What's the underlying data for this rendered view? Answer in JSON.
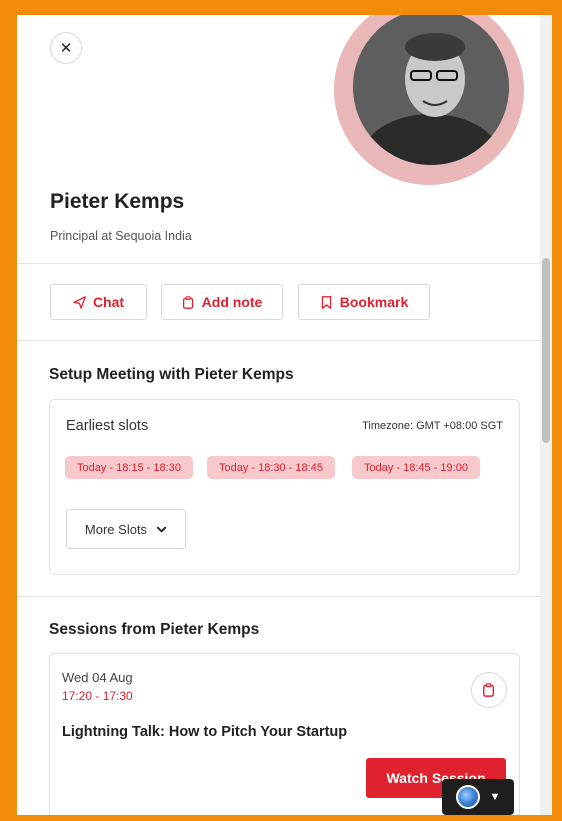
{
  "profile": {
    "name": "Pieter Kemps",
    "subtitle": "Principal at Sequoia India"
  },
  "actions": {
    "chat_label": "Chat",
    "add_note_label": "Add note",
    "bookmark_label": "Bookmark"
  },
  "meeting": {
    "title": "Setup Meeting with Pieter Kemps",
    "slots_label": "Earliest slots",
    "timezone": "Timezone: GMT +08:00 SGT",
    "slots": [
      "Today - 18:15 - 18:30",
      "Today - 18:30 - 18:45",
      "Today - 18:45 - 19:00"
    ],
    "more_slots_label": "More Slots"
  },
  "sessions": {
    "title": "Sessions from Pieter Kemps",
    "items": [
      {
        "date": "Wed 04 Aug",
        "time": "17:20 - 17:30",
        "title": "Lightning Talk: How to Pitch Your Startup",
        "watch_label": "Watch Session"
      }
    ]
  },
  "colors": {
    "accent": "#e0212e",
    "pill_bg": "#f7c9cc",
    "frame": "#f28a0a",
    "avatar_ring": "#e9b7b8"
  },
  "icons": {
    "close": "close-icon",
    "chat": "send-icon",
    "note": "clipboard-icon",
    "bookmark": "bookmark-icon",
    "more": "chevron-down-icon"
  }
}
